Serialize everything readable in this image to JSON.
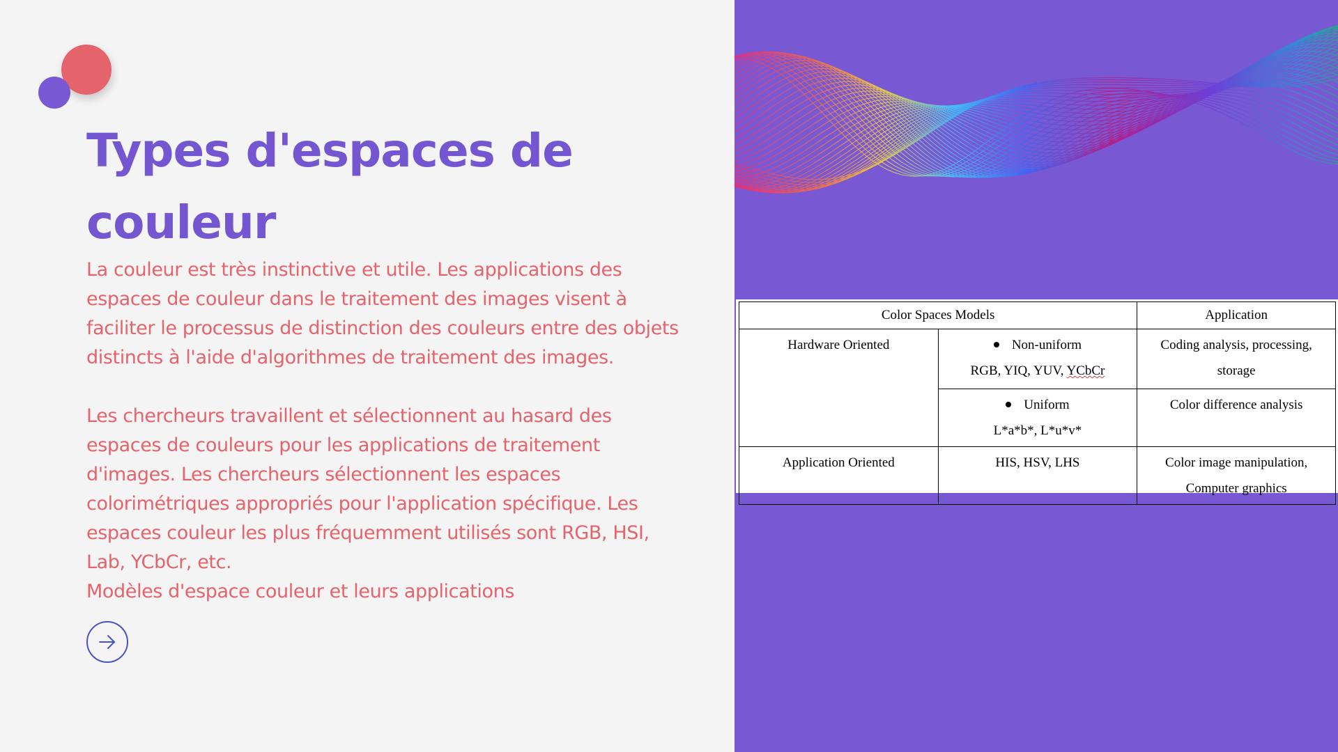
{
  "slide": {
    "title": "Types d'espaces de couleur",
    "paragraph1": "La couleur est très instinctive et utile. Les applications des espaces de couleur dans le traitement des images visent à faciliter le processus de distinction des couleurs entre des objets distincts à l'aide d'algorithmes de traitement des images.",
    "paragraph2": "Les chercheurs travaillent et sélectionnent au hasard des espaces de couleurs pour les applications de traitement d'images. Les chercheurs sélectionnent les espaces colorimétriques appropriés pour l'application spécifique. Les espaces couleur les plus fréquemment utilisés sont RGB, HSI, Lab, YCbCr, etc.",
    "paragraph3": "Modèles d'espace couleur et leurs applications",
    "next_icon": "arrow-right-icon"
  },
  "colors": {
    "title": "#7456d0",
    "body_text": "#e5636b",
    "panel": "#7859d3",
    "button_border": "#4752c4"
  },
  "table": {
    "header_models": "Color Spaces Models",
    "header_application": "Application",
    "row_hardware": "Hardware Oriented",
    "nonuniform_label": "Non-uniform",
    "nonuniform_spaces_prefix": "RGB, YIQ, YUV, ",
    "nonuniform_spaces_last": "YCbCr",
    "nonuniform_app_line1": "Coding analysis, processing,",
    "nonuniform_app_line2": "storage",
    "uniform_label": "Uniform",
    "uniform_spaces": "L*a*b*,  L*u*v*",
    "uniform_app": "Color difference analysis",
    "row_application": "Application Oriented",
    "app_spaces": "HIS, HSV, LHS",
    "app_app_line1": "Color image manipulation,",
    "app_app_line2": "Computer graphics"
  }
}
